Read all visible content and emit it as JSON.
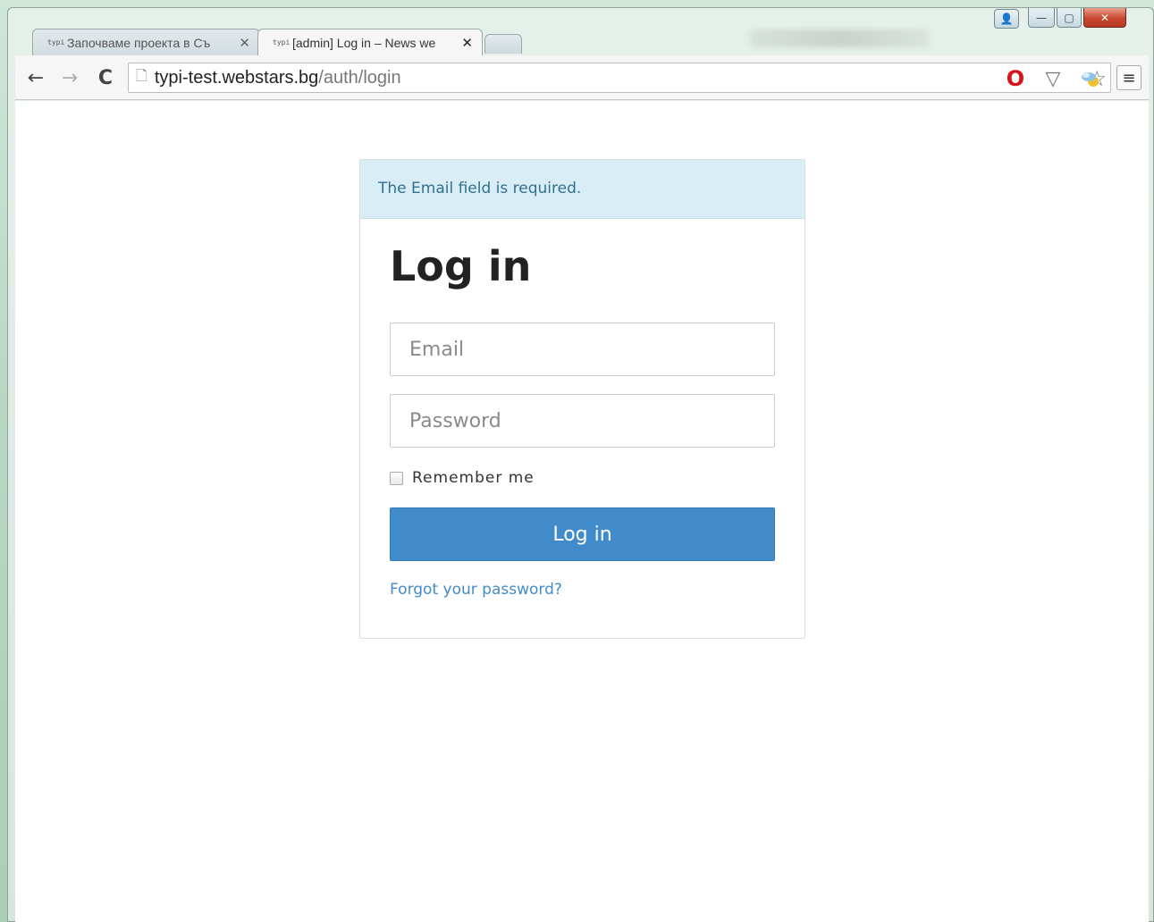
{
  "browser": {
    "tabs": [
      {
        "title": "Започваме проекта в Съ",
        "favicon": "typi"
      },
      {
        "title": "[admin] Log in – News we",
        "favicon": "typi",
        "active": true
      }
    ],
    "tab_close_symbol": "✕",
    "url_host": "typi-test.webstars.bg",
    "url_path": "/auth/login",
    "icons": {
      "back": "←",
      "forward": "→",
      "reload": "C",
      "page": "🗋",
      "star": "☆",
      "opera": "O",
      "shield": "▽",
      "menu": "≡"
    },
    "window_controls": {
      "profile": "👤",
      "minimize": "—",
      "maximize": "▢",
      "close": "✕"
    }
  },
  "page": {
    "alert": "The Email field is required.",
    "title": "Log in",
    "email_placeholder": "Email",
    "password_placeholder": "Password",
    "remember_label": "Remember me",
    "login_button": "Log in",
    "forgot_link": "Forgot your password?"
  },
  "colors": {
    "alert_bg": "#d9edf7",
    "alert_text": "#31708f",
    "primary": "#428bca",
    "link": "#428bca"
  }
}
